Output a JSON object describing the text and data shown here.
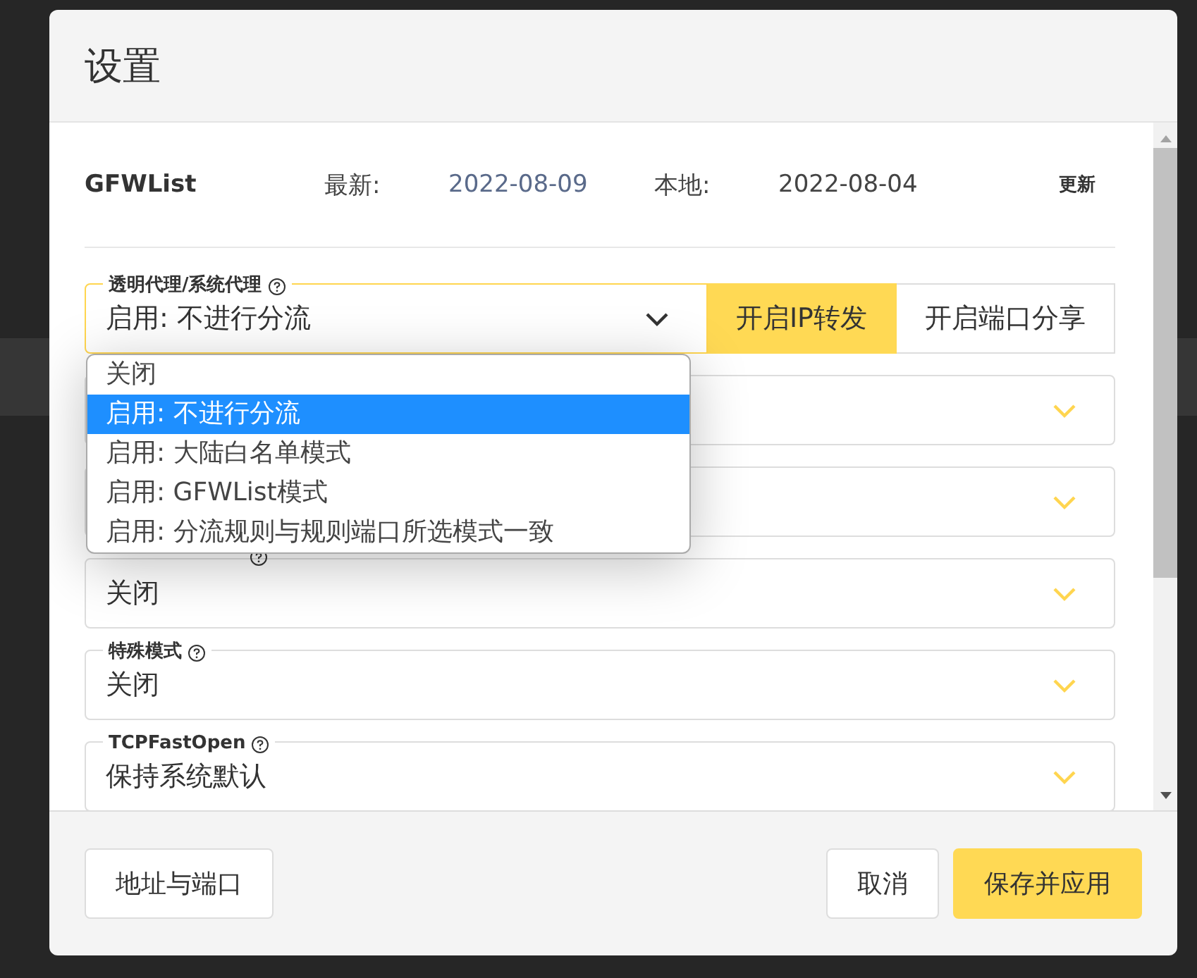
{
  "dialog": {
    "title": "设置"
  },
  "gfwlist": {
    "name": "GFWList",
    "latest_label": "最新:",
    "latest_date": "2022-08-09",
    "local_label": "本地:",
    "local_date": "2022-08-04",
    "update_button": "更新"
  },
  "fields": [
    {
      "label": "透明代理/系统代理",
      "help": true,
      "value": "启用: 不进行分流",
      "focused": true,
      "buttons": [
        {
          "label": "开启IP转发",
          "selected": true
        },
        {
          "label": "开启端口分享",
          "selected": false
        }
      ]
    },
    {
      "focused": false
    },
    {
      "focused": false
    },
    {
      "help": true,
      "value": "关闭",
      "focused": false
    },
    {
      "label": "特殊模式",
      "help": true,
      "value": "关闭",
      "focused": false
    },
    {
      "label": "TCPFastOpen",
      "help": true,
      "value": "保持系统默认",
      "focused": false
    }
  ],
  "dropdown": {
    "options": [
      {
        "label": "关闭",
        "selected": false
      },
      {
        "label": "启用: 不进行分流",
        "selected": true
      },
      {
        "label": "启用: 大陆白名单模式",
        "selected": false
      },
      {
        "label": "启用: GFWList模式",
        "selected": false
      },
      {
        "label": "启用: 分流规则与规则端口所选模式一致",
        "selected": false
      }
    ]
  },
  "footer": {
    "left_button": "地址与端口",
    "cancel_button": "取消",
    "save_button": "保存并应用"
  }
}
